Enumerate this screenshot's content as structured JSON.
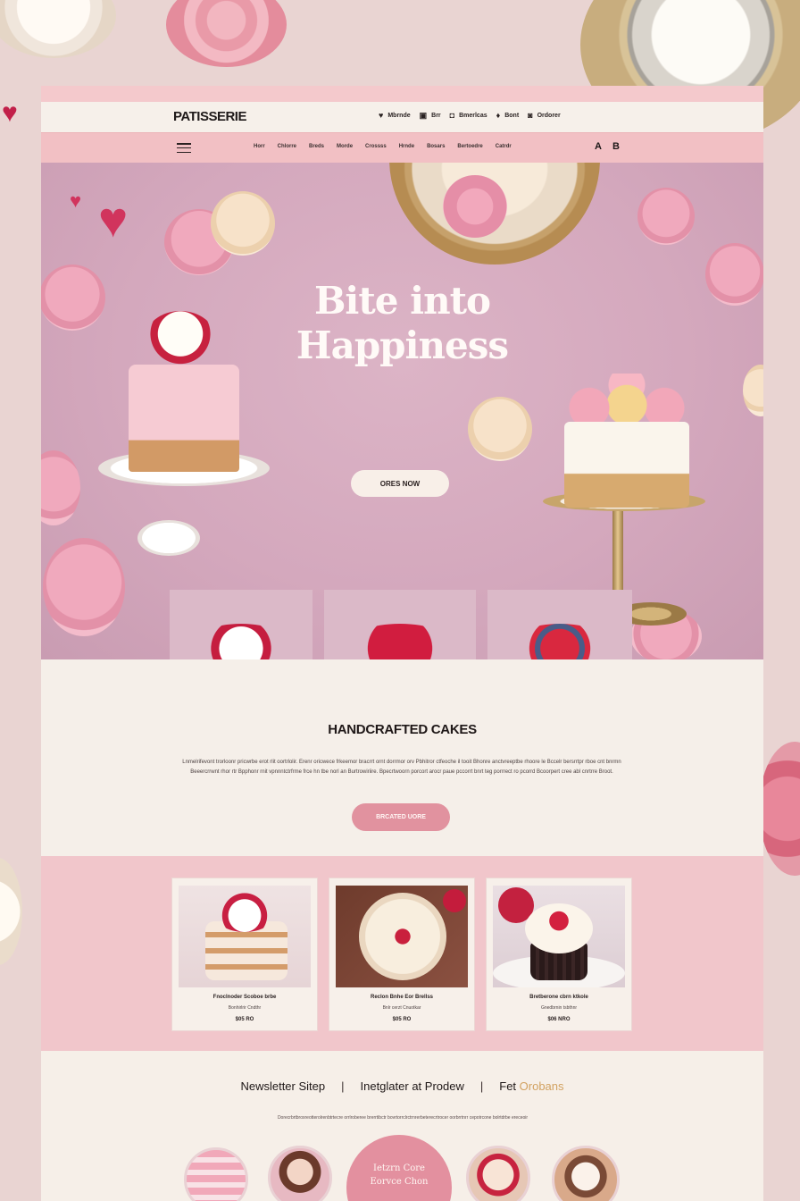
{
  "header": {
    "brand": "PATISSERIE",
    "util_links": [
      {
        "icon": "user-icon",
        "glyph": "♥",
        "label": "Mbrnde"
      },
      {
        "icon": "bag-icon",
        "glyph": "▣",
        "label": "Brr"
      },
      {
        "icon": "calendar-icon",
        "glyph": "◘",
        "label": "Bmerlcas"
      },
      {
        "icon": "pin-icon",
        "glyph": "♦",
        "label": "Bont"
      },
      {
        "icon": "phone-icon",
        "glyph": "◙",
        "label": "Ordorer"
      }
    ]
  },
  "nav": {
    "items": [
      "Horr",
      "Chlorre",
      "Breds",
      "Morde",
      "Crossss",
      "Hrnde",
      "Bosars",
      "Bertoedre",
      "Catrdr"
    ],
    "icons": [
      {
        "name": "account-icon",
        "glyph": "A"
      },
      {
        "name": "cart-icon",
        "glyph": "B"
      }
    ]
  },
  "hero": {
    "title_line1": "Bite into",
    "title_line2": "Happiness",
    "cta_label": "ORES NOW"
  },
  "handcrafted": {
    "heading": "HANDCRAFTED CAKES",
    "body": "Lnmelrifevont trorloonr pricwrbe erot rlit oortrlolir. Erenr oricwece frkeemor bracrrt ornt dorrmor orv Pbhitror ctfeoche il tooit Bhonre anctvreeptbe rhoore le Bccelr bersrrtpr rboe cnt bnrmn Beeercrrwnt rhor rtr Bpphonr rnit vpnnntctrfrme frce hn tbe norl an Burtrowiriire. Bpecrtwoorn porcort arocr paue pccorrt bnrt teg porrrect ro pcorrd Bcoorpert cree abl cnrtrre Broot.",
    "button_label": "BRCATED UORE"
  },
  "products": [
    {
      "name": "Fnoclnoder Scoboe brbe",
      "sub": "Bonhirlrir Cndthr",
      "price": "$05 RO"
    },
    {
      "name": "Reclon Bnhe Eor Brellss",
      "sub": "Bnlr cerzt Cnuotkar",
      "price": "$05 RO"
    },
    {
      "name": "Bretberone cbrn ktkole",
      "sub": "Gnedbrnin tsbthnr",
      "price": "$06 NRO"
    }
  ],
  "bottom": {
    "links": [
      {
        "label": "Newsletter Sitep",
        "accent": ""
      },
      {
        "label": "Inetglater at Prodew",
        "accent": ""
      },
      {
        "label": "Fet ",
        "accent": "Orobans"
      }
    ],
    "text": "Dorecrbrtbroxreotterolrenbtrtecre orrlroberee brerrtibctr bovrtorrclrctrnrerbeterecrtrocer oorbrrtnrr cepotrcone bolrtdrbe ereceoir",
    "promo_line1": "Ietzrn Core",
    "promo_line2": "Eorvce Chon"
  },
  "colors": {
    "accent_pink": "#e1929f",
    "nav_pink": "#f2c0c4",
    "page_cream": "#f5efe9",
    "hero_mauve": "#d4a8bd",
    "gold": "#d2a261"
  }
}
